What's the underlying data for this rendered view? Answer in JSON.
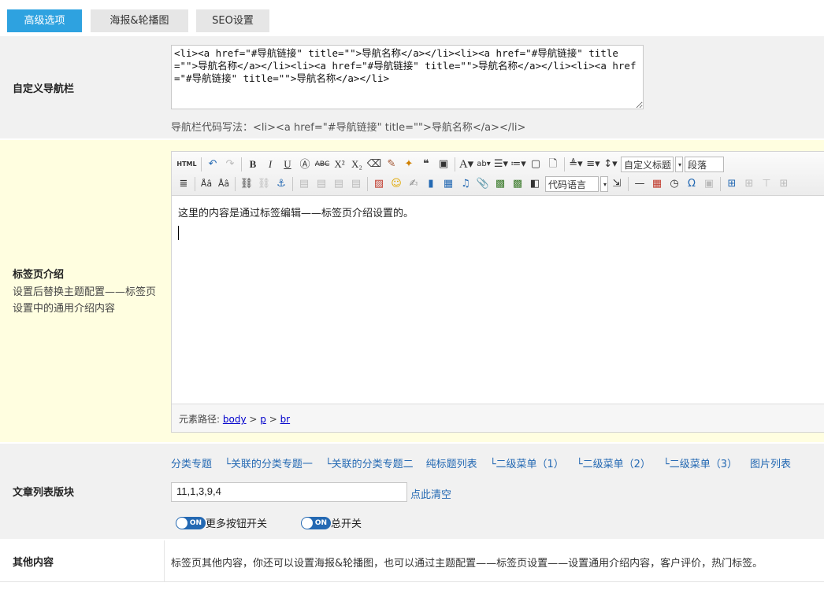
{
  "tabs": [
    "高级选项",
    "海报&轮播图",
    "SEO设置"
  ],
  "nav": {
    "label": "自定义导航栏",
    "code": "<li><a href=\"#导航链接\" title=\"\">导航名称</a></li><li><a href=\"#导航链接\" title=\"\">导航名称</a></li><li><a href=\"#导航链接\" title=\"\">导航名称</a></li><li><a href=\"#导航链接\" title=\"\">导航名称</a></li>",
    "hint": "导航栏代码写法：<li><a href=\"#导航链接\" title=\"\">导航名称</a></li>"
  },
  "intro": {
    "label": "标签页介绍",
    "desc": "设置后替换主题配置——标签页设置中的通用介绍内容",
    "editor_text": "这里的内容是通过标签编辑——标签页介绍设置的。",
    "toolbar": {
      "html_btn": "HTML",
      "font_family": "自定义标题",
      "paragraph": "段落",
      "code_lang": "代码语言"
    },
    "path_label": "元素路径:",
    "path": [
      "body",
      "p",
      "br"
    ]
  },
  "articles": {
    "label": "文章列表版块",
    "links": [
      "分类专题",
      "└关联的分类专题一",
      "└关联的分类专题二",
      "纯标题列表",
      "└二级菜单（1）",
      "└二级菜单（2）",
      "└二级菜单（3）",
      "图片列表"
    ],
    "ids_value": "11,1,3,9,4",
    "clear": "点此清空",
    "toggle_more": "更多按钮开关",
    "toggle_all": "总开关",
    "switch_text": "ON"
  },
  "other": {
    "label": "其他内容",
    "text": "标签页其他内容，你还可以设置海报&轮播图，也可以通过主题配置——标签页设置——设置通用介绍内容，客户评价，热门标签。"
  },
  "colors": {
    "accent": "#2ea2e0",
    "link": "#2469b3",
    "highlight_row": "#fffee0"
  }
}
